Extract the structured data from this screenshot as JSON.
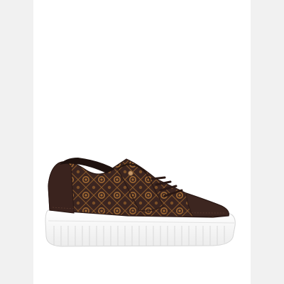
{
  "product": {
    "icon": "sneaker-image",
    "colors": {
      "upper": "#3b2520",
      "pattern": "#8a5a2b",
      "sole": "#ffffff",
      "background": "#ffffff",
      "frame": "#f1f1f1"
    }
  }
}
